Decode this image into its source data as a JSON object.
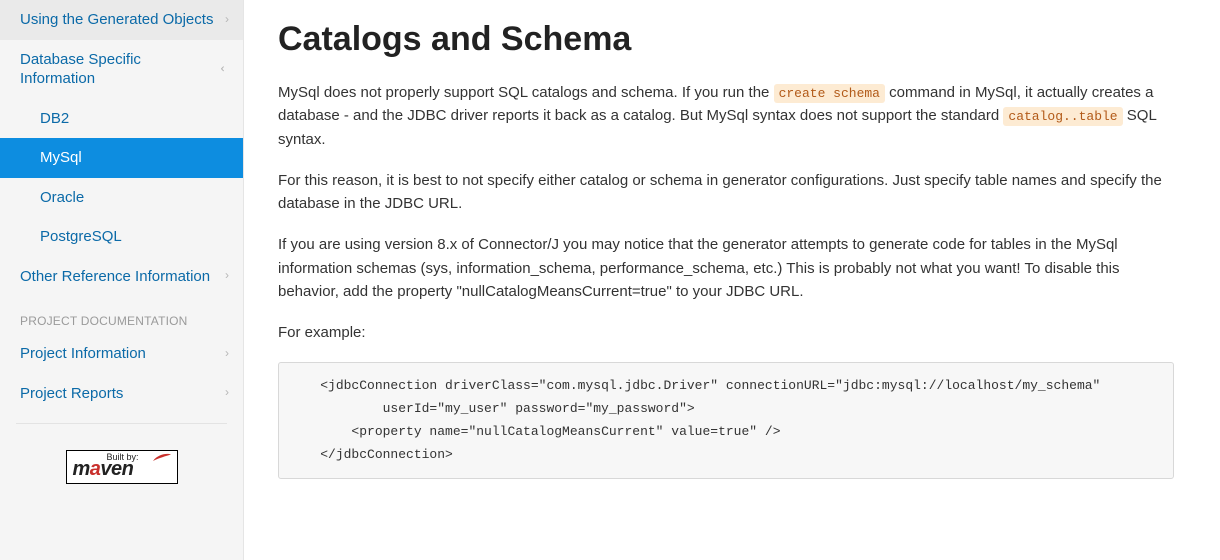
{
  "sidebar": {
    "items": [
      {
        "label": "Using the Generated Objects",
        "expanded": false
      },
      {
        "label": "Database Specific Information",
        "expanded": true,
        "children": [
          {
            "label": "DB2",
            "active": false
          },
          {
            "label": "MySql",
            "active": true
          },
          {
            "label": "Oracle",
            "active": false
          },
          {
            "label": "PostgreSQL",
            "active": false
          }
        ]
      },
      {
        "label": "Other Reference Information",
        "expanded": false
      }
    ],
    "section_header": "PROJECT DOCUMENTATION",
    "proj_items": [
      {
        "label": "Project Information"
      },
      {
        "label": "Project Reports"
      }
    ],
    "built_by": {
      "top": "Built by:",
      "main_left": "m",
      "main_a": "a",
      "main_right": "ven"
    }
  },
  "content": {
    "title": "Catalogs and Schema",
    "p1_a": "MySql does not properly support SQL catalogs and schema. If you run the ",
    "p1_code1": "create schema",
    "p1_b": " command in MySql, it actually creates a database - and the JDBC driver reports it back as a catalog. But MySql syntax does not support the standard ",
    "p1_code2": "catalog..table",
    "p1_c": " SQL syntax.",
    "p2": "For this reason, it is best to not specify either catalog or schema in generator configurations. Just specify table names and specify the database in the JDBC URL.",
    "p3": "If you are using version 8.x of Connector/J you may notice that the generator attempts to generate code for tables in the MySql information schemas (sys, information_schema, performance_schema, etc.) This is probably not what you want! To disable this behavior, add the property \"nullCatalogMeansCurrent=true\" to your JDBC URL.",
    "p4": "For example:",
    "codeblock": "    <jdbcConnection driverClass=\"com.mysql.jdbc.Driver\" connectionURL=\"jdbc:mysql://localhost/my_schema\"\n            userId=\"my_user\" password=\"my_password\">\n        <property name=\"nullCatalogMeansCurrent\" value=true\" />\n    </jdbcConnection>"
  }
}
